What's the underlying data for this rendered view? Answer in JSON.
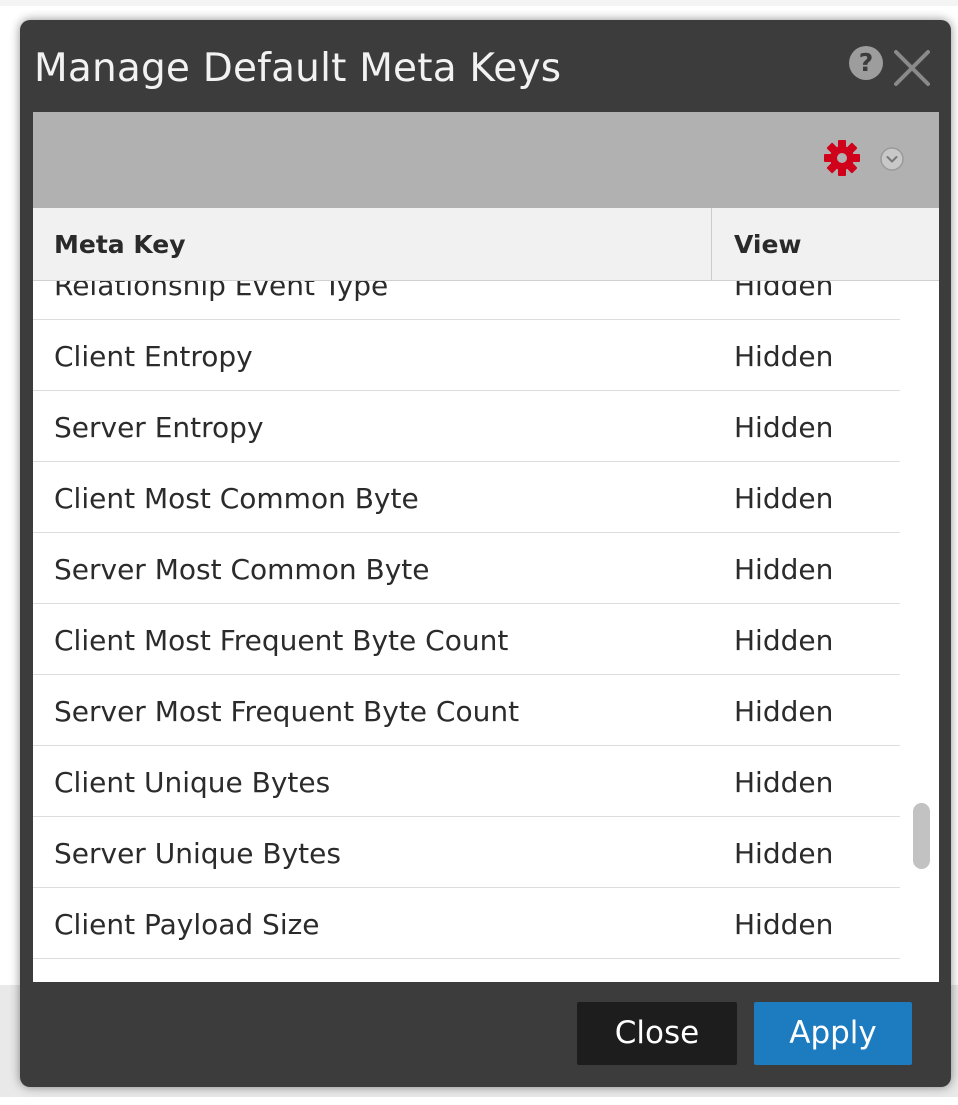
{
  "dialog": {
    "title": "Manage Default Meta Keys",
    "help_icon": "question-circle-icon",
    "close_icon": "close-x-icon"
  },
  "toolbar": {
    "settings_icon": "gear-icon",
    "dropdown_icon": "chevron-down-circle-icon",
    "accent_color": "#d0021b"
  },
  "grid": {
    "columns": [
      "Meta Key",
      "View"
    ],
    "rows": [
      {
        "key": "Relationship Event Type",
        "view": "Hidden"
      },
      {
        "key": "Client Entropy",
        "view": "Hidden"
      },
      {
        "key": "Server Entropy",
        "view": "Hidden"
      },
      {
        "key": "Client Most Common Byte",
        "view": "Hidden"
      },
      {
        "key": "Server Most Common Byte",
        "view": "Hidden"
      },
      {
        "key": "Client Most Frequent Byte Count",
        "view": "Hidden"
      },
      {
        "key": "Server Most Frequent Byte Count",
        "view": "Hidden"
      },
      {
        "key": "Client Unique Bytes",
        "view": "Hidden"
      },
      {
        "key": "Server Unique Bytes",
        "view": "Hidden"
      },
      {
        "key": "Client Payload Size",
        "view": "Hidden"
      }
    ]
  },
  "footer": {
    "close_label": "Close",
    "apply_label": "Apply",
    "apply_color": "#1d7bbf"
  }
}
